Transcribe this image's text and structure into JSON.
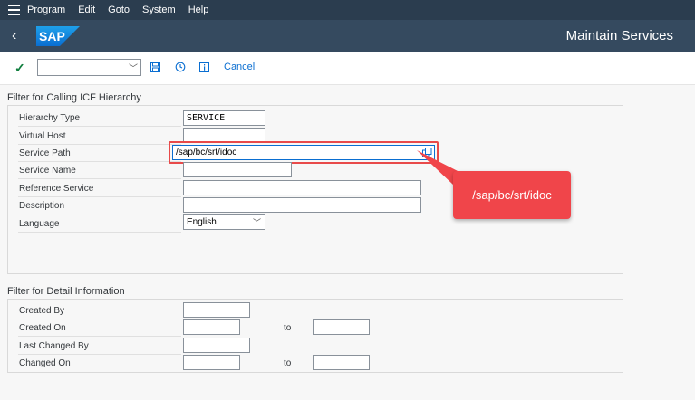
{
  "menubar": {
    "items": [
      {
        "label": "Program",
        "mnemonic": "P"
      },
      {
        "label": "Edit",
        "mnemonic": "E"
      },
      {
        "label": "Goto",
        "mnemonic": "G"
      },
      {
        "label": "System",
        "mnemonic": "y"
      },
      {
        "label": "Help",
        "mnemonic": "H"
      }
    ]
  },
  "titlebar": {
    "title": "Maintain Services",
    "logo": "SAP"
  },
  "toolbar": {
    "command_value": "",
    "cancel_label": "Cancel",
    "icons": [
      "check-icon",
      "save-icon",
      "history-icon",
      "info-icon"
    ]
  },
  "section1": {
    "title": "Filter for Calling ICF Hierarchy",
    "fields": [
      {
        "label": "Hierarchy Type",
        "value": "SERVICE"
      },
      {
        "label": "Virtual Host",
        "value": ""
      },
      {
        "label": "Service Path",
        "value": "/sap/bc/srt/idoc"
      },
      {
        "label": "Service Name",
        "value": ""
      },
      {
        "label": "Reference Service",
        "value": ""
      },
      {
        "label": "Description",
        "value": ""
      },
      {
        "label": "Language",
        "value": "English"
      }
    ]
  },
  "section2": {
    "title": "Filter for Detail Information",
    "to_label": "to",
    "fields": [
      {
        "label": "Created By",
        "value": ""
      },
      {
        "label": "Created On",
        "value": "",
        "to_value": ""
      },
      {
        "label": "Last Changed By",
        "value": ""
      },
      {
        "label": "Changed On",
        "value": "",
        "to_value": ""
      }
    ]
  },
  "callout": {
    "text": "/sap/bc/srt/idoc"
  },
  "colors": {
    "menubar": "#2b3d4f",
    "titlebar": "#354a5f",
    "accent": "#0a6ed1",
    "callout": "#f0454a",
    "ok": "#107e3e"
  }
}
